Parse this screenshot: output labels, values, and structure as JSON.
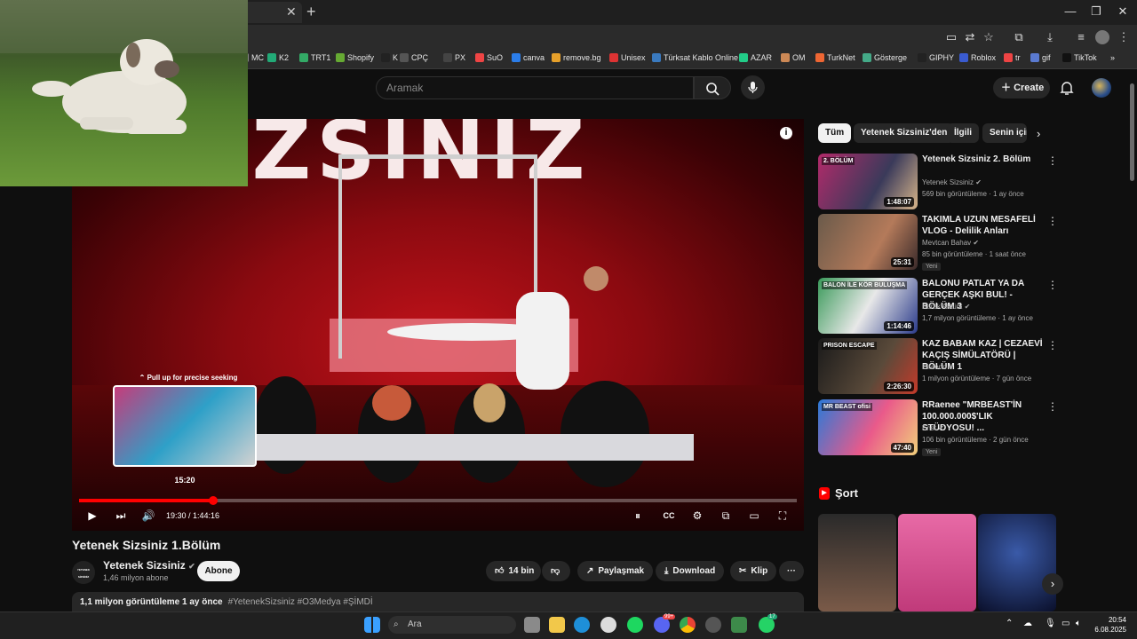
{
  "browser": {
    "bookmarks": [
      "MC",
      "K2",
      "TRT1",
      "Shopify",
      "K",
      "CPÇ",
      "PX",
      "SuO",
      "canva",
      "remove.bg",
      "Unisex",
      "Türksat Kablo Online",
      "AZAR",
      "OM",
      "TurkNet",
      "Gösterge",
      "GIPHY",
      "Roblox",
      "tr",
      "gif",
      "TikTok"
    ],
    "more": "»"
  },
  "header": {
    "search_placeholder": "Aramak",
    "create_label": "Create"
  },
  "player": {
    "stage_text": "SIZSINIZ",
    "preview_hint": "Pull up for precise seeking",
    "preview_time": "15:20",
    "current_time": "19:30 / 1:44:16",
    "progress": 0.187
  },
  "video": {
    "title": "Yetenek Sizsiniz 1.Bölüm",
    "channel_logo_text": "YETENEK SİZSİNİZ",
    "channel": "Yetenek Sizsiniz",
    "subscribers": "1,46 milyon abone",
    "subscribe_label": "Abone",
    "likes": "14 bin",
    "share_label": "Paylaşmak",
    "download_label": "Download",
    "clip_label": "Klip",
    "views_date": "1,1 milyon görüntüleme 1 ay önce",
    "hashtags": "#YetenekSizsiniz #O3Medya #ŞİMDİ"
  },
  "sidebar": {
    "chips": [
      "Tüm",
      "Yetenek Sizsiniz'den",
      "İlgili",
      "Senin için"
    ],
    "recommendations": [
      {
        "title": "Yetenek Sizsiniz 2. Bölüm",
        "channel": "Yetenek Sizsiniz",
        "meta": "569 bin görüntüleme · 1 ay önce",
        "duration": "1:48:07",
        "thumb_label": "2. BÖLÜM",
        "new": ""
      },
      {
        "title": "TAKIMLA UZUN MESAFELİ VLOG - Delilik Anları",
        "channel": "Mevtcan Bahav",
        "meta": "85 bin görüntüleme · 1 saat önce",
        "duration": "25:31",
        "thumb_label": "",
        "new": "Yeni"
      },
      {
        "title": "BALONU PATLAT YA DA GERÇEK AŞKI BUL! - BÖLÜM 3",
        "channel": "Burak Aktürk",
        "meta": "1,7 milyon görüntüleme · 1 ay önce",
        "duration": "1:14:46",
        "thumb_label": "BALON İLE KÖR BULUŞMA",
        "new": ""
      },
      {
        "title": "KAZ BABAM KAZ | CEZAEVİ KAÇIŞ SİMÜLATÖRÜ | BÖLÜM 1",
        "channel": "Elraenn",
        "meta": "1 milyon görüntüleme · 7 gün önce",
        "duration": "2:26:30",
        "thumb_label": "PRISON ESCAPE",
        "new": ""
      },
      {
        "title": "RRaenee \"MRBEAST'İN 100.000.000$'LIK STÜDYOSU! ...",
        "channel": "Enst",
        "meta": "106 bin görüntüleme · 2 gün önce",
        "duration": "47:40",
        "thumb_label": "MR BEAST ofisi",
        "new": "Yeni"
      }
    ],
    "shorts_title": "Şort"
  },
  "taskbar": {
    "search_label": "Ara",
    "time": "20:54",
    "date": "6.08.2025",
    "badge_discord": "99+",
    "badge_whatsapp": "17"
  },
  "colors": {
    "accent_red": "#ff0000",
    "background": "#0f0f0f",
    "surface": "#272727"
  }
}
